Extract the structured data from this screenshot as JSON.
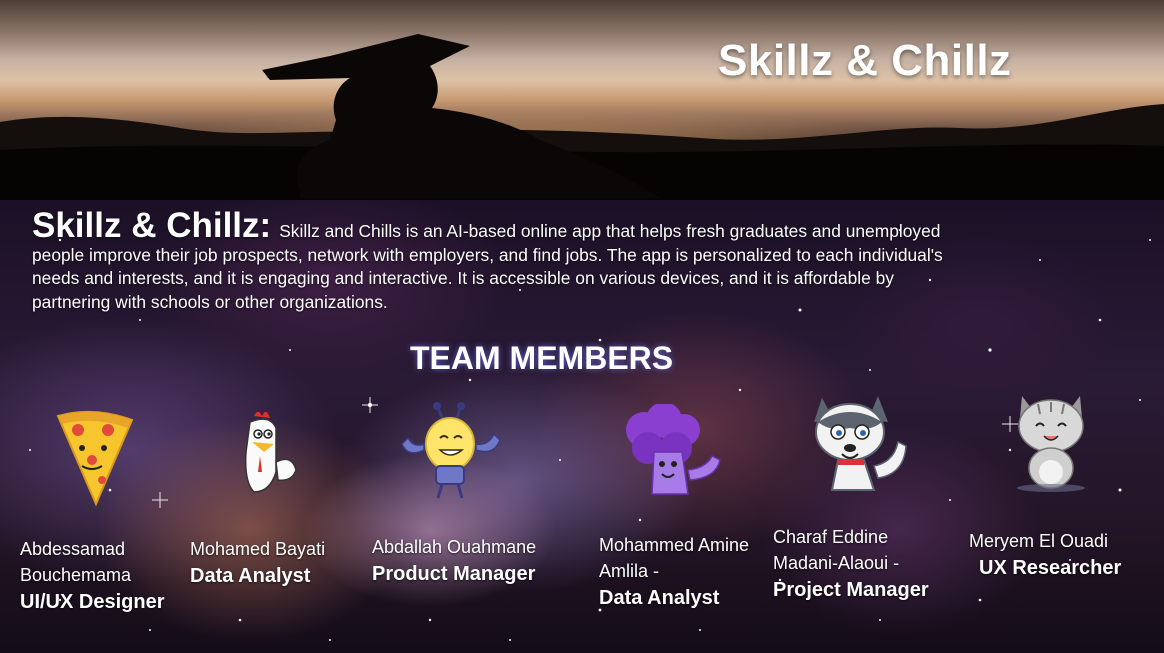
{
  "hero": {
    "title": "Skillz & Chillz"
  },
  "intro": {
    "heading": "Skillz & Chillz:",
    "text": "Skillz and Chills is an AI-based online app that helps fresh graduates and unemployed people improve their job prospects, network with employers, and find jobs. The app is personalized to each individual's needs and interests, and it is engaging and interactive. It is accessible on various devices, and it is affordable by partnering with schools or other organizations."
  },
  "team": {
    "heading": "TEAM MEMBERS",
    "members": [
      {
        "avatar": "pizza-icon",
        "name": "Abdessamad Bouchemama",
        "role": "UI/UX Designer"
      },
      {
        "avatar": "chicken-icon",
        "name": "Mohamed Bayati",
        "role": "Data Analyst"
      },
      {
        "avatar": "lightbulb-icon",
        "name": "Abdallah Ouahmane",
        "role": "Product Manager"
      },
      {
        "avatar": "broccoli-icon",
        "name": "Mohammed Amine Amlila -",
        "role": "Data Analyst"
      },
      {
        "avatar": "husky-dog-icon",
        "name": "Charaf Eddine Madani-Alaoui -",
        "role": "Project Manager"
      },
      {
        "avatar": "cat-icon",
        "name": "Meryem El Ouadi",
        "role": "UX  Researcher"
      }
    ]
  }
}
